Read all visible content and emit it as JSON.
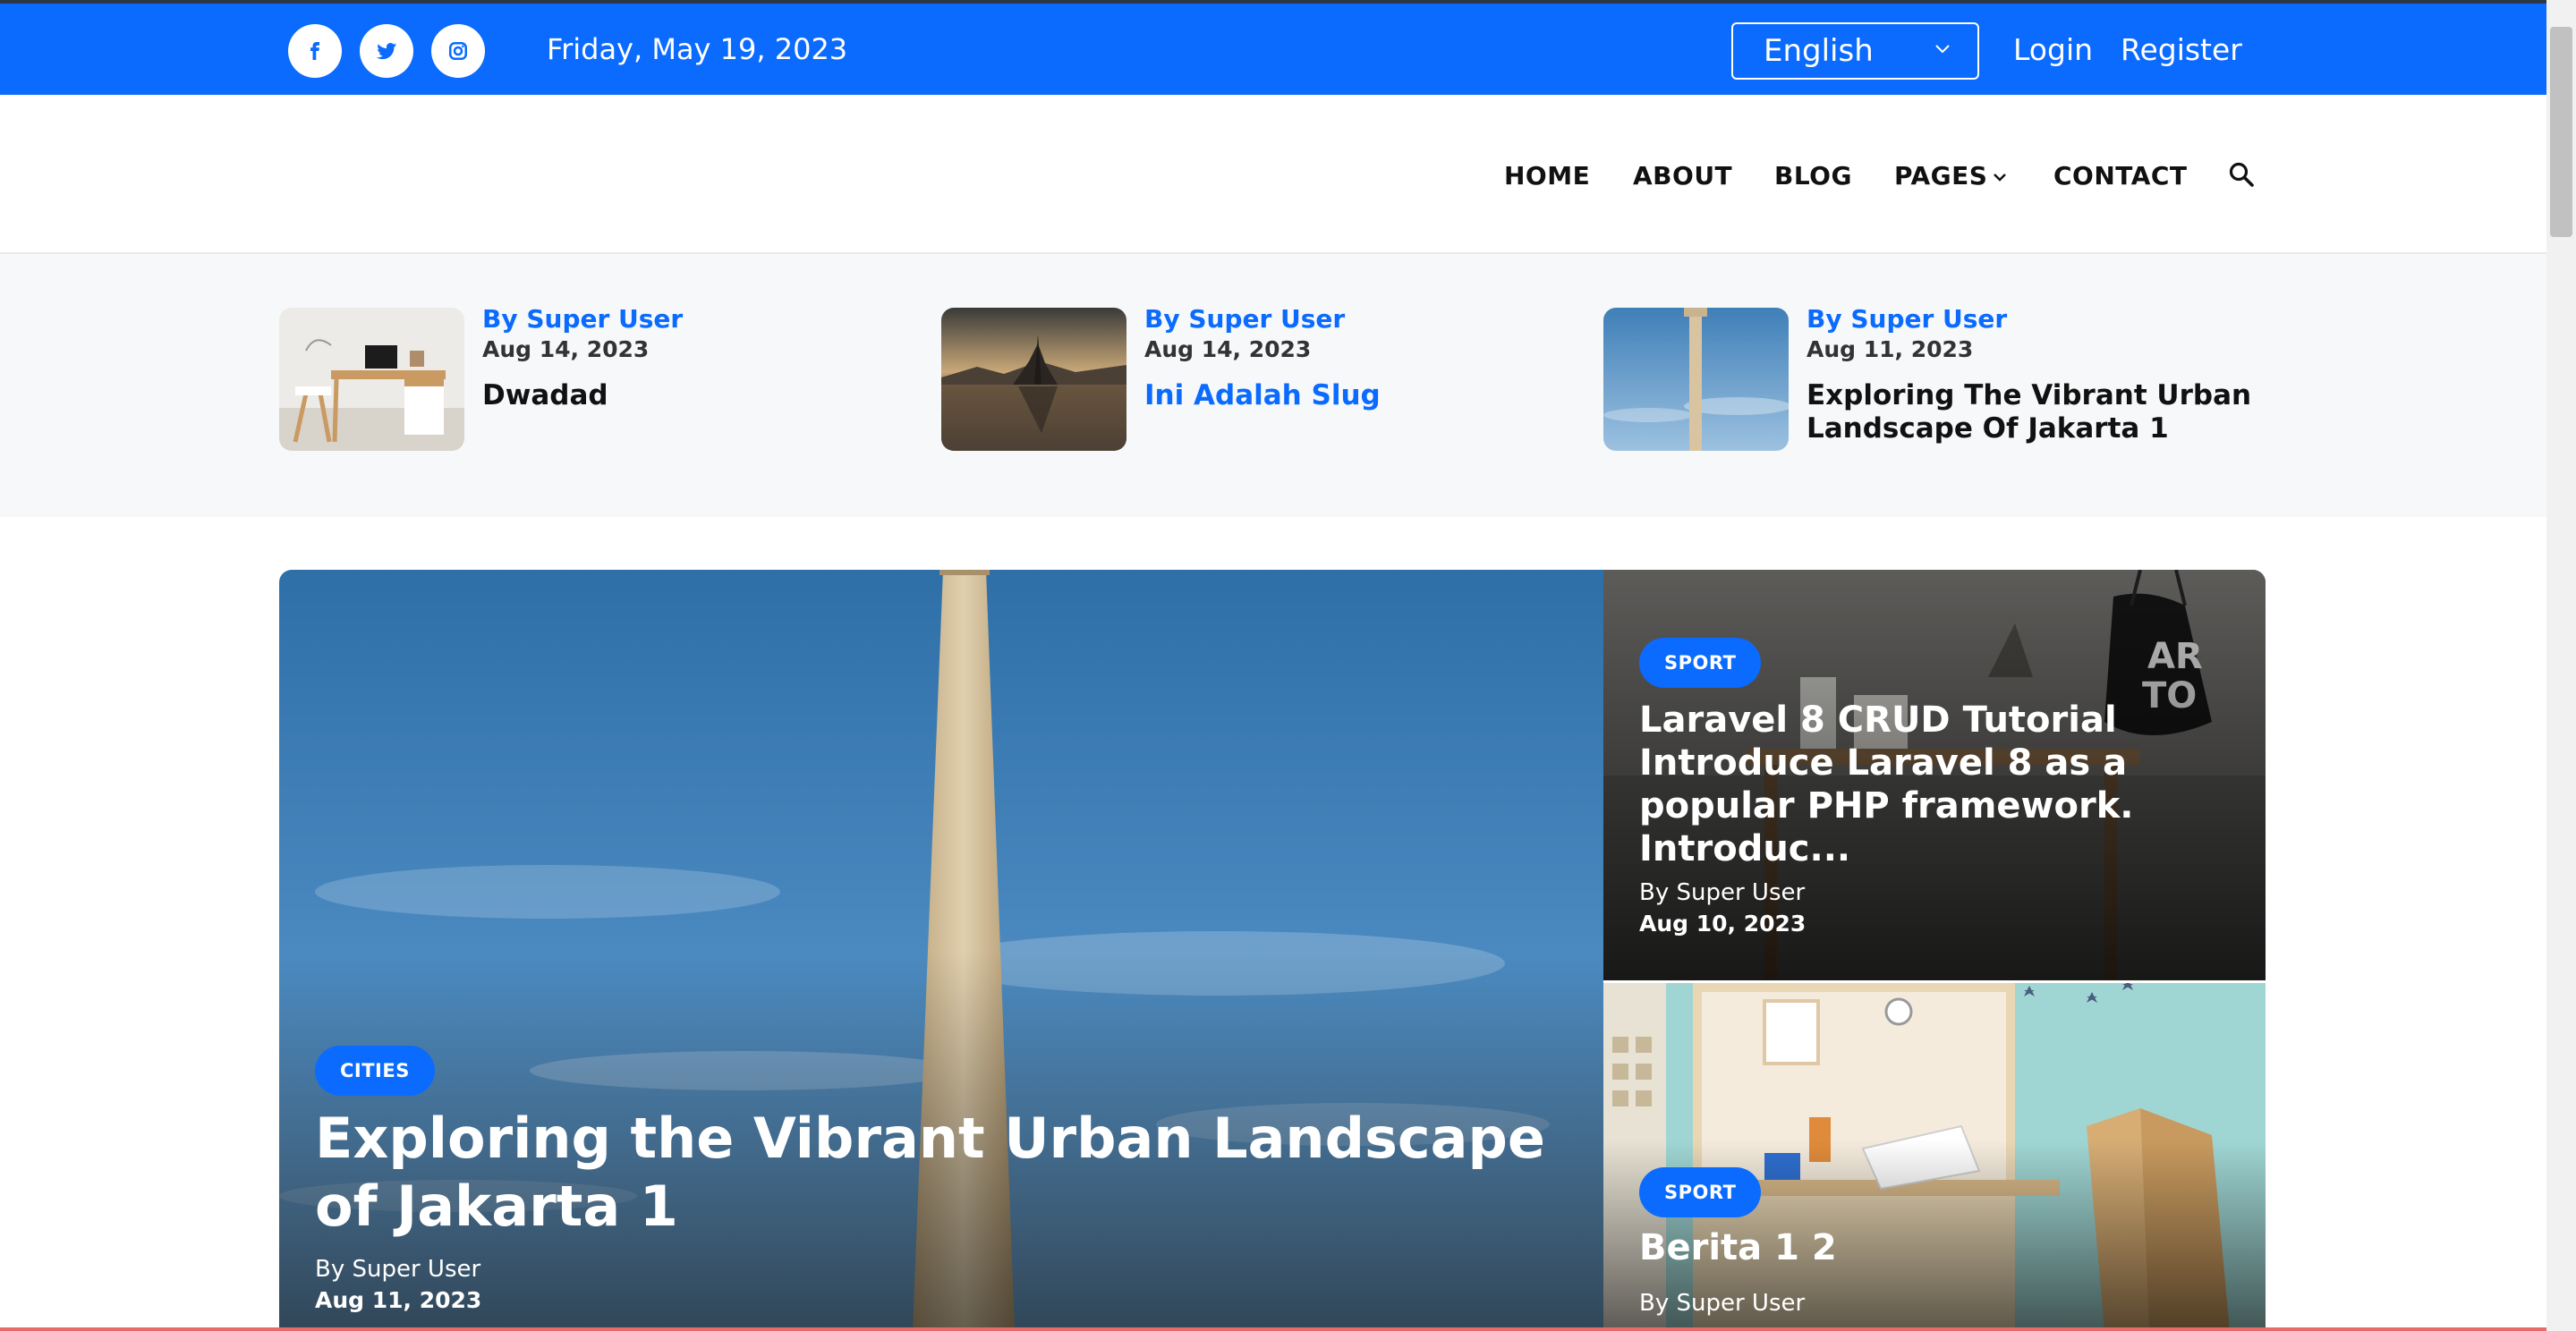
{
  "topbar": {
    "social": [
      {
        "name": "facebook",
        "glyph": "f"
      },
      {
        "name": "twitter",
        "glyph": "t"
      },
      {
        "name": "instagram",
        "glyph": "ig"
      }
    ],
    "date": "Friday, May 19, 2023",
    "language": "English",
    "login_label": "Login",
    "register_label": "Register",
    "bg_color": "#0b6bff"
  },
  "nav": {
    "items": [
      "HOME",
      "ABOUT",
      "BLOG",
      "PAGES",
      "CONTACT"
    ],
    "search_icon": "search-icon"
  },
  "latest": [
    {
      "author": "By Super User",
      "date": "Aug 14, 2023",
      "title": "Dwadad",
      "highlight": false
    },
    {
      "author": "By Super User",
      "date": "Aug 14, 2023",
      "title": "Ini Adalah Slug",
      "highlight": true
    },
    {
      "author": "By Super User",
      "date": "Aug 11, 2023",
      "title": "Exploring The Vibrant Urban Landscape Of Jakarta 1",
      "highlight": false
    }
  ],
  "hero": {
    "main": {
      "category": "CITIES",
      "title": "Exploring the Vibrant Urban Landscape of Jakarta 1",
      "author": "By Super User",
      "date": "Aug 11, 2023"
    },
    "side": [
      {
        "category": "SPORT",
        "title": "Laravel 8 CRUD Tutorial Introduce Laravel 8 as a popular PHP framework. Introduc...",
        "author": "By Super User",
        "date": "Aug 10, 2023"
      },
      {
        "category": "SPORT",
        "title": "Berita 1 2",
        "author": "By Super User"
      }
    ]
  },
  "colors": {
    "accent": "#0b6bff",
    "strip_bg": "#f6f8fa"
  }
}
